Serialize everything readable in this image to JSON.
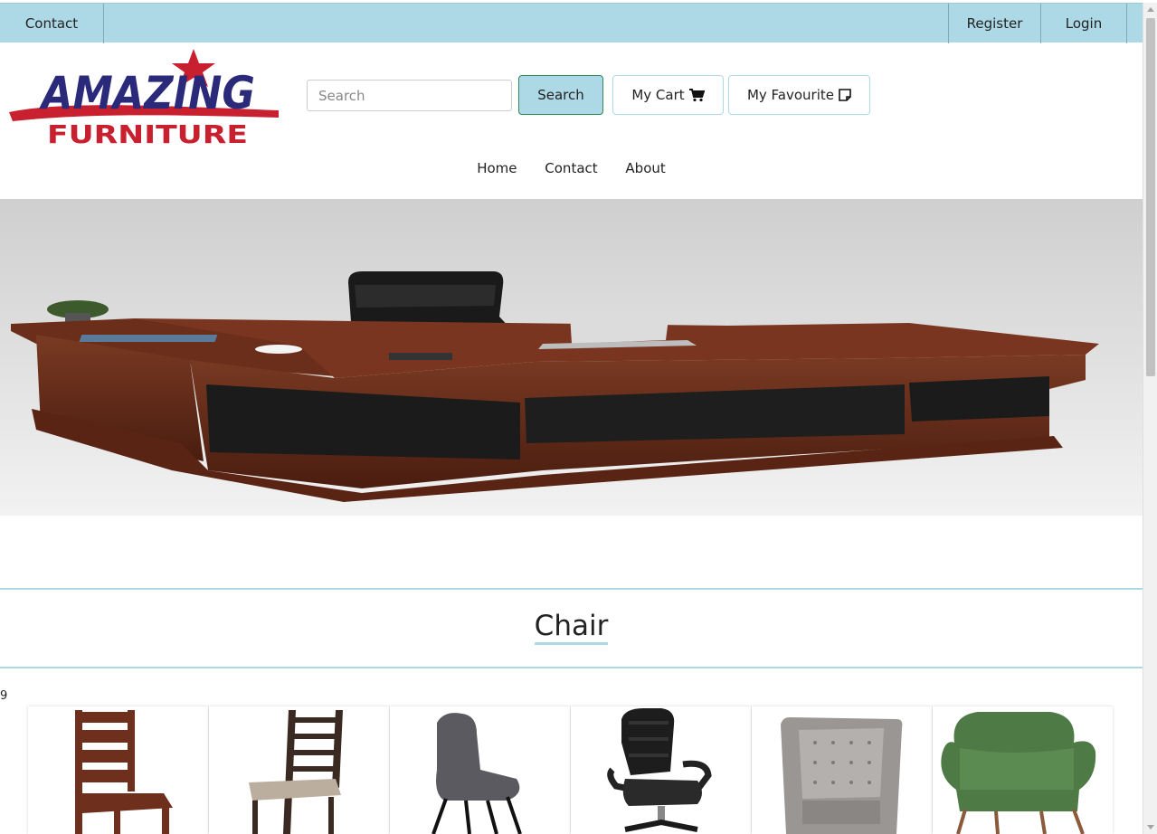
{
  "topbar": {
    "contact": "Contact",
    "register": "Register",
    "login": "Login"
  },
  "logo": {
    "line1": "AMAZING",
    "line2": "FURNITURE"
  },
  "search": {
    "placeholder": "Search",
    "button_label": "Search"
  },
  "actions": {
    "cart_label": "My Cart",
    "favourite_label": "My Favourite"
  },
  "nav": {
    "items": [
      "Home",
      "Contact",
      "About"
    ]
  },
  "section": {
    "title": "Chair",
    "count": "9"
  },
  "products": [
    {
      "name": "wooden-dining-chair"
    },
    {
      "name": "ladder-back-chair"
    },
    {
      "name": "grey-fabric-chair"
    },
    {
      "name": "black-office-chair"
    },
    {
      "name": "grey-wingback-chair"
    },
    {
      "name": "green-armchair"
    }
  ],
  "colors": {
    "accent": "#add8e6",
    "logo_blue": "#2b2a7a",
    "logo_red": "#c8202f"
  }
}
